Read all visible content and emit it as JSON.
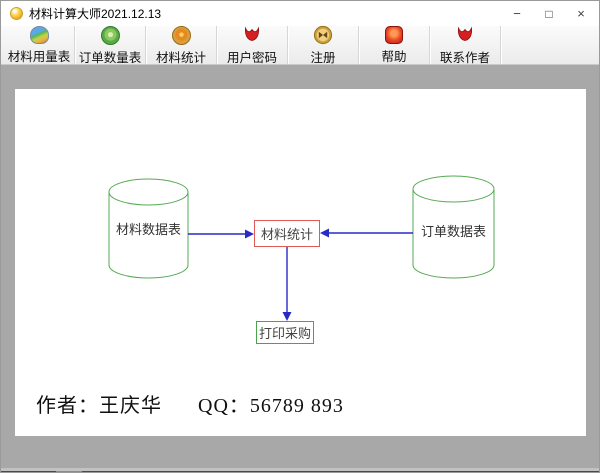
{
  "window": {
    "title": "材料计算大师2021.12.13",
    "controls": {
      "minimize": "−",
      "maximize": "□",
      "close": "×"
    }
  },
  "toolbar": {
    "buttons": [
      {
        "label": "材料用量表",
        "icon": "material-usage-table-icon"
      },
      {
        "label": "订单数量表",
        "icon": "order-quantity-table-icon"
      },
      {
        "label": "材料统计",
        "icon": "material-statistics-icon"
      },
      {
        "label": "用户密码",
        "icon": "user-password-tulip-icon"
      },
      {
        "label": "注册",
        "icon": "register-coin-icon"
      },
      {
        "label": "帮助",
        "icon": "help-gem-icon"
      },
      {
        "label": "联系作者",
        "icon": "contact-author-tulip-icon"
      }
    ]
  },
  "diagram": {
    "left_database": "材料数据表",
    "right_database": "订单数据表",
    "center_process": "材料统计",
    "output_box": "打印采购",
    "author_text": "作者：王庆华",
    "qq_text": "QQ：56789 893"
  },
  "colors": {
    "cylinder_green": "#55aa55",
    "arrow_blue": "#2929c8",
    "process_border_red": "#e05a5a",
    "output_border_green": "#4aa44a",
    "client_gray": "#a8a8a8",
    "title_icon_gold": "#f0a818"
  }
}
